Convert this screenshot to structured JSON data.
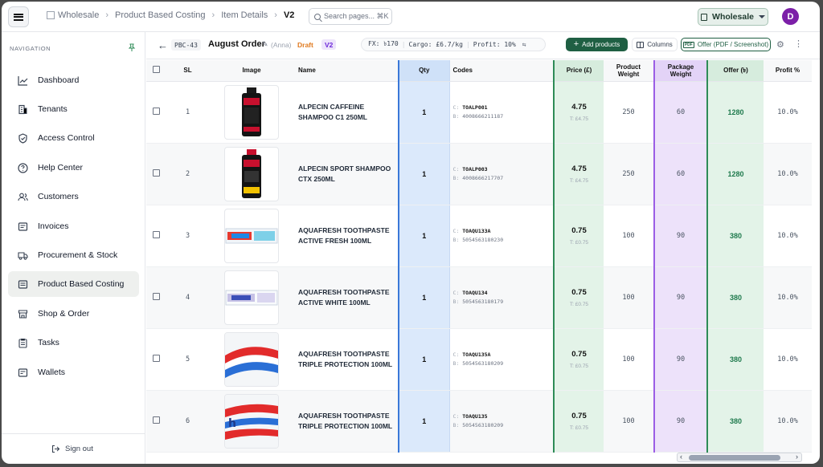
{
  "topbar": {
    "breadcrumbs": [
      "Wholesale",
      "Product Based Costing",
      "Item Details",
      "V2"
    ],
    "search_placeholder": "Search pages... ⌘K",
    "workspace": "Wholesale",
    "avatar_initial": "D"
  },
  "sidebar": {
    "title": "NAVIGATION",
    "items": [
      {
        "label": "Dashboard",
        "icon": "chart-line-icon"
      },
      {
        "label": "Tenants",
        "icon": "building-icon"
      },
      {
        "label": "Access Control",
        "icon": "shield-check-icon"
      },
      {
        "label": "Help Center",
        "icon": "help-circle-icon"
      },
      {
        "label": "Customers",
        "icon": "users-icon"
      },
      {
        "label": "Invoices",
        "icon": "invoice-icon"
      },
      {
        "label": "Procurement & Stock",
        "icon": "truck-icon"
      },
      {
        "label": "Product Based Costing",
        "icon": "document-icon"
      },
      {
        "label": "Shop & Order",
        "icon": "store-icon"
      },
      {
        "label": "Tasks",
        "icon": "clipboard-icon"
      },
      {
        "label": "Wallets",
        "icon": "wallet-icon"
      }
    ],
    "active_index": 7,
    "signout": "Sign out"
  },
  "subheader": {
    "code": "PBC-43",
    "title": "August Order",
    "owner": "(Anna)",
    "status": "Draft",
    "version": "V2",
    "fx": "FX: ৳170",
    "cargo": "Cargo: £6.7/kg",
    "profit": "Profit: 10%",
    "add_products": "Add products",
    "columns": "Columns",
    "offer": "Offer (PDF / Screenshot)"
  },
  "table": {
    "headers": {
      "sl": "SL",
      "image": "Image",
      "name": "Name",
      "qty": "Qty",
      "codes": "Codes",
      "price": "Price (£)",
      "weight": "Product Weight",
      "pkg": "Package Weight",
      "offer": "Offer (৳)",
      "profit": "Profit %"
    },
    "rows": [
      {
        "sl": "1",
        "name1": "ALPECIN CAFFEINE",
        "name2": "SHAMPOO C1 250ML",
        "qty": "1",
        "code_c": "TOALP001",
        "code_b": "4008666211187",
        "price": "4.75",
        "price_t": "T: £4.75",
        "weight": "250",
        "pkg": "60",
        "offer": "1280",
        "profit": "10.0%",
        "img": "bottle-c1"
      },
      {
        "sl": "2",
        "name1": "ALPECIN SPORT SHAMPOO",
        "name2": "CTX 250ML",
        "qty": "1",
        "code_c": "TOALP003",
        "code_b": "4008666217707",
        "price": "4.75",
        "price_t": "T: £4.75",
        "weight": "250",
        "pkg": "60",
        "offer": "1280",
        "profit": "10.0%",
        "img": "bottle-ctx"
      },
      {
        "sl": "3",
        "name1": "AQUAFRESH TOOTHPASTE",
        "name2": "ACTIVE FRESH 100ML",
        "qty": "1",
        "code_c": "TOAQU133A",
        "code_b": "5054563180230",
        "price": "0.75",
        "price_t": "T: £0.75",
        "weight": "100",
        "pkg": "90",
        "offer": "380",
        "profit": "10.0%",
        "img": "box-fresh"
      },
      {
        "sl": "4",
        "name1": "AQUAFRESH TOOTHPASTE",
        "name2": "ACTIVE WHITE 100ML",
        "qty": "1",
        "code_c": "TOAQU134",
        "code_b": "5054563180179",
        "price": "0.75",
        "price_t": "T: £0.75",
        "weight": "100",
        "pkg": "90",
        "offer": "380",
        "profit": "10.0%",
        "img": "box-white"
      },
      {
        "sl": "5",
        "name1": "AQUAFRESH TOOTHPASTE",
        "name2": "TRIPLE PROTECTION 100ML",
        "qty": "1",
        "code_c": "TOAQU135A",
        "code_b": "5054563180209",
        "price": "0.75",
        "price_t": "T: £0.75",
        "weight": "100",
        "pkg": "90",
        "offer": "380",
        "profit": "10.0%",
        "img": "stripes"
      },
      {
        "sl": "6",
        "name1": "AQUAFRESH TOOTHPASTE",
        "name2": "TRIPLE PROTECTION 100ML",
        "qty": "1",
        "code_c": "TOAQU135",
        "code_b": "5054563180209",
        "price": "0.75",
        "price_t": "T: £0.75",
        "weight": "100",
        "pkg": "90",
        "offer": "380",
        "profit": "10.0%",
        "img": "stripes-h"
      }
    ]
  }
}
